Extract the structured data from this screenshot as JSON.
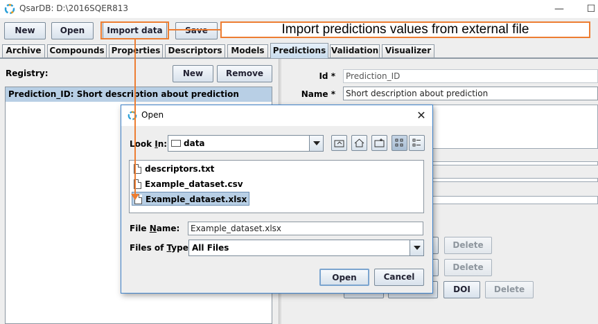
{
  "window": {
    "title": "QsarDB: D:\\2016SQER813",
    "minimize_glyph": "—",
    "maximize_glyph": "☐"
  },
  "toolbar": {
    "new_label": "New",
    "open_label": "Open",
    "import_label": "Import data",
    "save_label": "Save"
  },
  "annotation": {
    "text": "Import predictions values from external file",
    "color": "#ed7d31"
  },
  "tabs": [
    {
      "label": "Archive"
    },
    {
      "label": "Compounds"
    },
    {
      "label": "Properties"
    },
    {
      "label": "Descriptors"
    },
    {
      "label": "Models"
    },
    {
      "label": "Predictions",
      "active": true
    },
    {
      "label": "Validation"
    },
    {
      "label": "Visualizer"
    }
  ],
  "registry": {
    "label": "Registry:",
    "new_label": "New",
    "remove_label": "Remove",
    "items": [
      {
        "text": "Prediction_ID: Short description about prediction",
        "selected": true
      }
    ]
  },
  "detail": {
    "id_label": "Id",
    "id_value": "Prediction_ID",
    "name_label": "Name",
    "name_value": "Short description about prediction",
    "required_mark": "*",
    "delete_label": "Delete",
    "doi_label": "DOI"
  },
  "dialog": {
    "title": "Open",
    "close_glyph": "✕",
    "look_in_label_pre": "Look ",
    "look_in_label_u": "I",
    "look_in_label_post": "n:",
    "look_in_value": "data",
    "files": [
      {
        "name": "descriptors.txt",
        "selected": false
      },
      {
        "name": "Example_dataset.csv",
        "selected": false
      },
      {
        "name": "Example_dataset.xlsx",
        "selected": true
      }
    ],
    "file_name_label_pre": "File ",
    "file_name_label_u": "N",
    "file_name_label_post": "ame:",
    "file_name_value": "Example_dataset.xlsx",
    "file_type_label_pre": "Files of ",
    "file_type_label_u": "T",
    "file_type_label_post": "ype:",
    "file_type_value": "All Files",
    "open_label": "Open",
    "cancel_label": "Cancel"
  },
  "colors": {
    "selection": "#b8cfe5",
    "dialog_border": "#3c80c8",
    "accent_orange": "#ed7d31"
  }
}
